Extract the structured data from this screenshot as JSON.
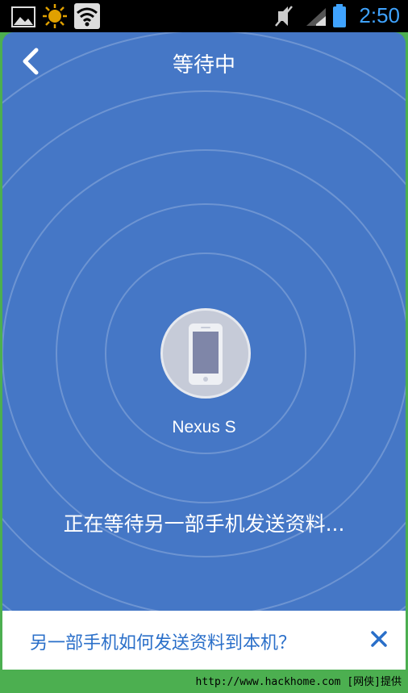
{
  "status_bar": {
    "time": "2:50",
    "time_color": "#3fa3ff",
    "icons": [
      "image-icon",
      "weather-sun-icon",
      "wifi-icon",
      "mute-icon",
      "signal-icon",
      "battery-icon"
    ]
  },
  "header": {
    "back_icon": "back-arrow-icon",
    "title": "等待中"
  },
  "main": {
    "device_icon": "phone-icon",
    "device_name": "Nexus S",
    "waiting_text": "正在等待另一部手机发送资料..."
  },
  "bottom_bar": {
    "help_text": "另一部手机如何发送资料到本机？",
    "close_icon": "close-icon"
  },
  "watermark": "http://www.hackhome.com [网侠]提供",
  "colors": {
    "background": "#4577c6",
    "accent_link": "#2a6fc9",
    "outer_frame": "#4caf50"
  }
}
